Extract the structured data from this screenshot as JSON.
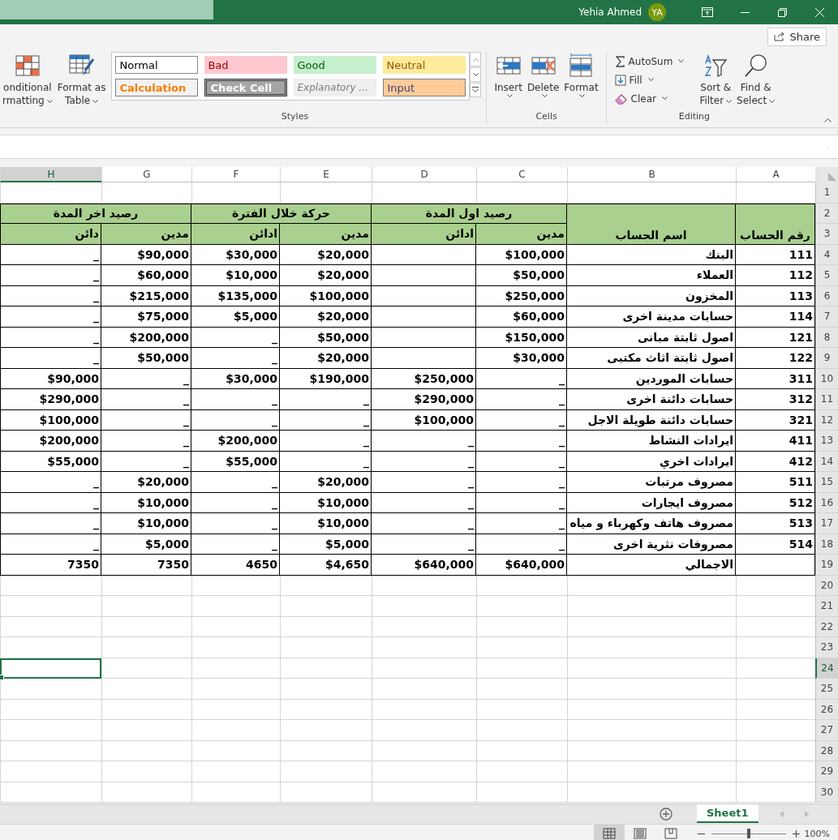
{
  "title_bar": {
    "user_name": "Yehia Ahmed",
    "avatar_initials": "YA"
  },
  "share_button": "Share",
  "ribbon": {
    "format_buttons": [
      {
        "line1": "onditional",
        "line2": "rmatting"
      },
      {
        "line1": "Format as",
        "line2": "Table"
      }
    ],
    "styles": {
      "label": "Styles",
      "items": [
        {
          "text": "Normal",
          "kind": "normal"
        },
        {
          "text": "Bad",
          "kind": "bad"
        },
        {
          "text": "Good",
          "kind": "good"
        },
        {
          "text": "Neutral",
          "kind": "neutral"
        },
        {
          "text": "Calculation",
          "kind": "calculation"
        },
        {
          "text": "Check Cell",
          "kind": "check"
        },
        {
          "text": "Explanatory ...",
          "kind": "explanatory"
        },
        {
          "text": "Input",
          "kind": "input"
        }
      ]
    },
    "cells": {
      "label": "Cells",
      "buttons": [
        {
          "text": "Insert"
        },
        {
          "text": "Delete"
        },
        {
          "text": "Format"
        }
      ]
    },
    "editing": {
      "label": "Editing",
      "small_buttons": [
        {
          "text": "AutoSum"
        },
        {
          "text": "Fill"
        },
        {
          "text": "Clear"
        }
      ],
      "big_buttons": [
        {
          "line1": "Sort &",
          "line2": "Filter"
        },
        {
          "line1": "Find &",
          "line2": "Select"
        }
      ]
    }
  },
  "sheet": {
    "columns": [
      {
        "label": "H",
        "selected": true
      },
      {
        "label": "G",
        "selected": false
      },
      {
        "label": "F",
        "selected": false
      },
      {
        "label": "E",
        "selected": false
      },
      {
        "label": "D",
        "selected": false
      },
      {
        "label": "C",
        "selected": false
      },
      {
        "label": "B",
        "selected": false
      },
      {
        "label": "A",
        "selected": false
      }
    ],
    "row_numbers": [
      {
        "label": "1",
        "selected": false
      },
      {
        "label": "2",
        "selected": false
      },
      {
        "label": "3",
        "selected": false
      },
      {
        "label": "4",
        "selected": false
      },
      {
        "label": "5",
        "selected": false
      },
      {
        "label": "6",
        "selected": false
      },
      {
        "label": "7",
        "selected": false
      },
      {
        "label": "8",
        "selected": false
      },
      {
        "label": "9",
        "selected": false
      },
      {
        "label": "10",
        "selected": false
      },
      {
        "label": "11",
        "selected": false
      },
      {
        "label": "12",
        "selected": false
      },
      {
        "label": "13",
        "selected": false
      },
      {
        "label": "14",
        "selected": false
      },
      {
        "label": "15",
        "selected": false
      },
      {
        "label": "16",
        "selected": false
      },
      {
        "label": "17",
        "selected": false
      },
      {
        "label": "18",
        "selected": false
      },
      {
        "label": "19",
        "selected": false
      },
      {
        "label": "20",
        "selected": false
      },
      {
        "label": "21",
        "selected": false
      },
      {
        "label": "22",
        "selected": false
      },
      {
        "label": "23",
        "selected": false
      },
      {
        "label": "24",
        "selected": true
      },
      {
        "label": "25",
        "selected": false
      },
      {
        "label": "26",
        "selected": false
      },
      {
        "label": "27",
        "selected": false
      },
      {
        "label": "28",
        "selected": false
      },
      {
        "label": "29",
        "selected": false
      },
      {
        "label": "30",
        "selected": false
      }
    ],
    "header": {
      "groups": [
        {
          "title": "رصيد اول المدة",
          "subs": [
            "مدين",
            "ادائن"
          ]
        },
        {
          "title": "حركة خلال الفترة",
          "subs": [
            "مدين",
            "ادائن"
          ]
        },
        {
          "title": "رصيد اخر المدة",
          "subs": [
            "مدين",
            "دائن"
          ]
        }
      ],
      "account_name": "اسم الحساب",
      "account_no": "رقم الحساب"
    },
    "rows": [
      [
        "_",
        "$90,000",
        "$30,000",
        "$20,000",
        null,
        "$100,000",
        "البنك",
        "111"
      ],
      [
        "_",
        "$60,000",
        "$10,000",
        "$20,000",
        null,
        "$50,000",
        "العملاء",
        "112"
      ],
      [
        "_",
        "$215,000",
        "$135,000",
        "$100,000",
        null,
        "$250,000",
        "المخزون",
        "113"
      ],
      [
        "_",
        "$75,000",
        "$5,000",
        "$20,000",
        null,
        "$60,000",
        "حسابات مدينة اخرى",
        "114"
      ],
      [
        "_",
        "$200,000",
        "_",
        "$50,000",
        null,
        "$150,000",
        "اصول ثابتة مبانى",
        "121"
      ],
      [
        "_",
        "$50,000",
        "_",
        "$20,000",
        null,
        "$30,000",
        "اصول ثابتة اثاث مكتبى",
        "122"
      ],
      [
        "$90,000",
        "_",
        "$30,000",
        "$190,000",
        "$250,000",
        "_",
        "حسابات الموردين",
        "311"
      ],
      [
        "$290,000",
        "_",
        "_",
        "_",
        "$290,000",
        "_",
        "حسابات دائنة اخرى",
        "312"
      ],
      [
        "$100,000",
        "_",
        "_",
        "_",
        "$100,000",
        "_",
        "حسابات دائنة طويلة الاجل",
        "321"
      ],
      [
        "$200,000",
        "_",
        "$200,000",
        "_",
        "_",
        "_",
        "ايرادات النشاط",
        "411"
      ],
      [
        "$55,000",
        "_",
        "$55,000",
        "_",
        "_",
        "_",
        "ايرادات اخري",
        "412"
      ],
      [
        "_",
        "$20,000",
        "_",
        "$20,000",
        "_",
        "_",
        "مصروف مرتبات",
        "511"
      ],
      [
        "_",
        "$10,000",
        "_",
        "$10,000",
        "_",
        "_",
        "مصروف ايجارات",
        "512"
      ],
      [
        "_",
        "$10,000",
        "_",
        "$10,000",
        "_",
        "_",
        "مصروف هاتف وكهرباء و مياه",
        "513"
      ],
      [
        "_",
        "$5,000",
        "_",
        "$5,000",
        "_",
        "_",
        "مصروفات نثرية اخرى",
        "514"
      ],
      [
        "7350",
        "7350",
        "4650",
        "$4,650",
        "$640,000",
        "$640,000",
        "الاجمالي",
        null
      ]
    ]
  },
  "sheet_tabs": [
    {
      "label": "Sheet1",
      "selected": true
    }
  ],
  "status_bar": {
    "views": [
      {
        "kind": "normal",
        "selected": true
      },
      {
        "kind": "page_layout",
        "selected": false
      },
      {
        "kind": "page_break",
        "selected": false
      }
    ],
    "zoom": {
      "level": 0.5,
      "reading": "100%"
    }
  }
}
